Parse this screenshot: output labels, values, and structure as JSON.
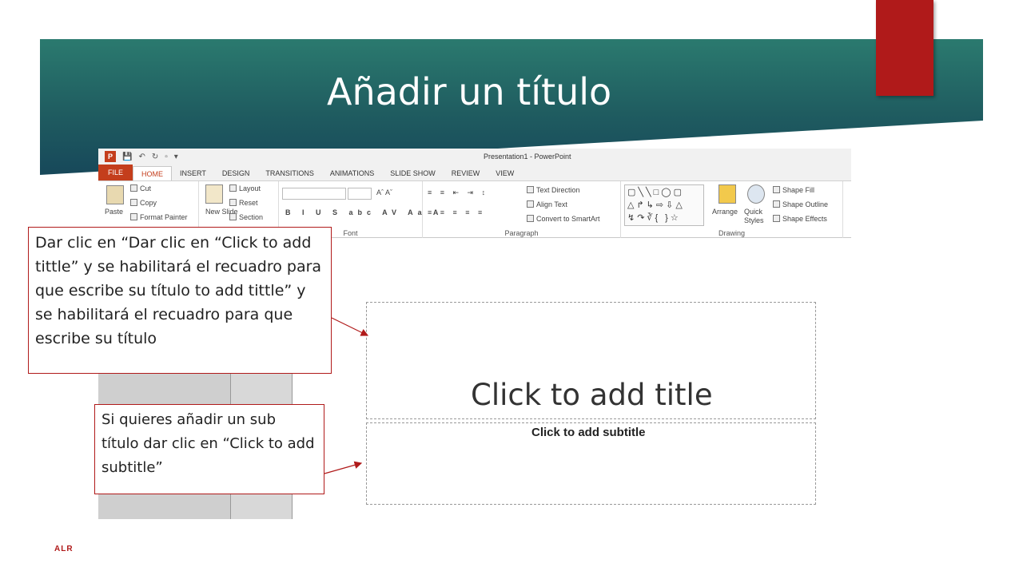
{
  "slide": {
    "title": "Añadir un título",
    "footer": "ALR"
  },
  "powerpoint": {
    "window_title": "Presentation1 - PowerPoint",
    "qat_logo": "P",
    "tabs": [
      "FILE",
      "HOME",
      "INSERT",
      "DESIGN",
      "TRANSITIONS",
      "ANIMATIONS",
      "SLIDE SHOW",
      "REVIEW",
      "VIEW"
    ],
    "active_tab": "HOME",
    "clipboard": {
      "paste": "Paste",
      "cut": "Cut",
      "copy": "Copy",
      "format_painter": "Format Painter"
    },
    "slides": {
      "new_slide": "New Slide",
      "layout": "Layout",
      "reset": "Reset",
      "section": "Section"
    },
    "groups": {
      "font": "Font",
      "paragraph": "Paragraph",
      "drawing": "Drawing"
    },
    "paragraph": {
      "text_direction": "Text Direction",
      "align_text": "Align Text",
      "convert_smartart": "Convert to SmartArt"
    },
    "drawing": {
      "arrange": "Arrange",
      "quick_styles": "Quick Styles",
      "shape_fill": "Shape Fill",
      "shape_outline": "Shape Outline",
      "shape_effects": "Shape Effects"
    },
    "placeholders": {
      "title": "Click to add title",
      "subtitle": "Click to add subtitle"
    }
  },
  "callouts": {
    "title_note": "Dar clic en “Dar clic en “Click to add tittle” y se habilitará el recuadro para que escribe su título to add tittle” y se habilitará el recuadro para que escribe su título",
    "subtitle_note": "Si quieres añadir un sub título dar clic en “Click to add subtitle”"
  },
  "colors": {
    "band_teal": "#2b7a6f",
    "accent_red": "#b01a1a",
    "ppt_orange": "#c43e1c"
  }
}
